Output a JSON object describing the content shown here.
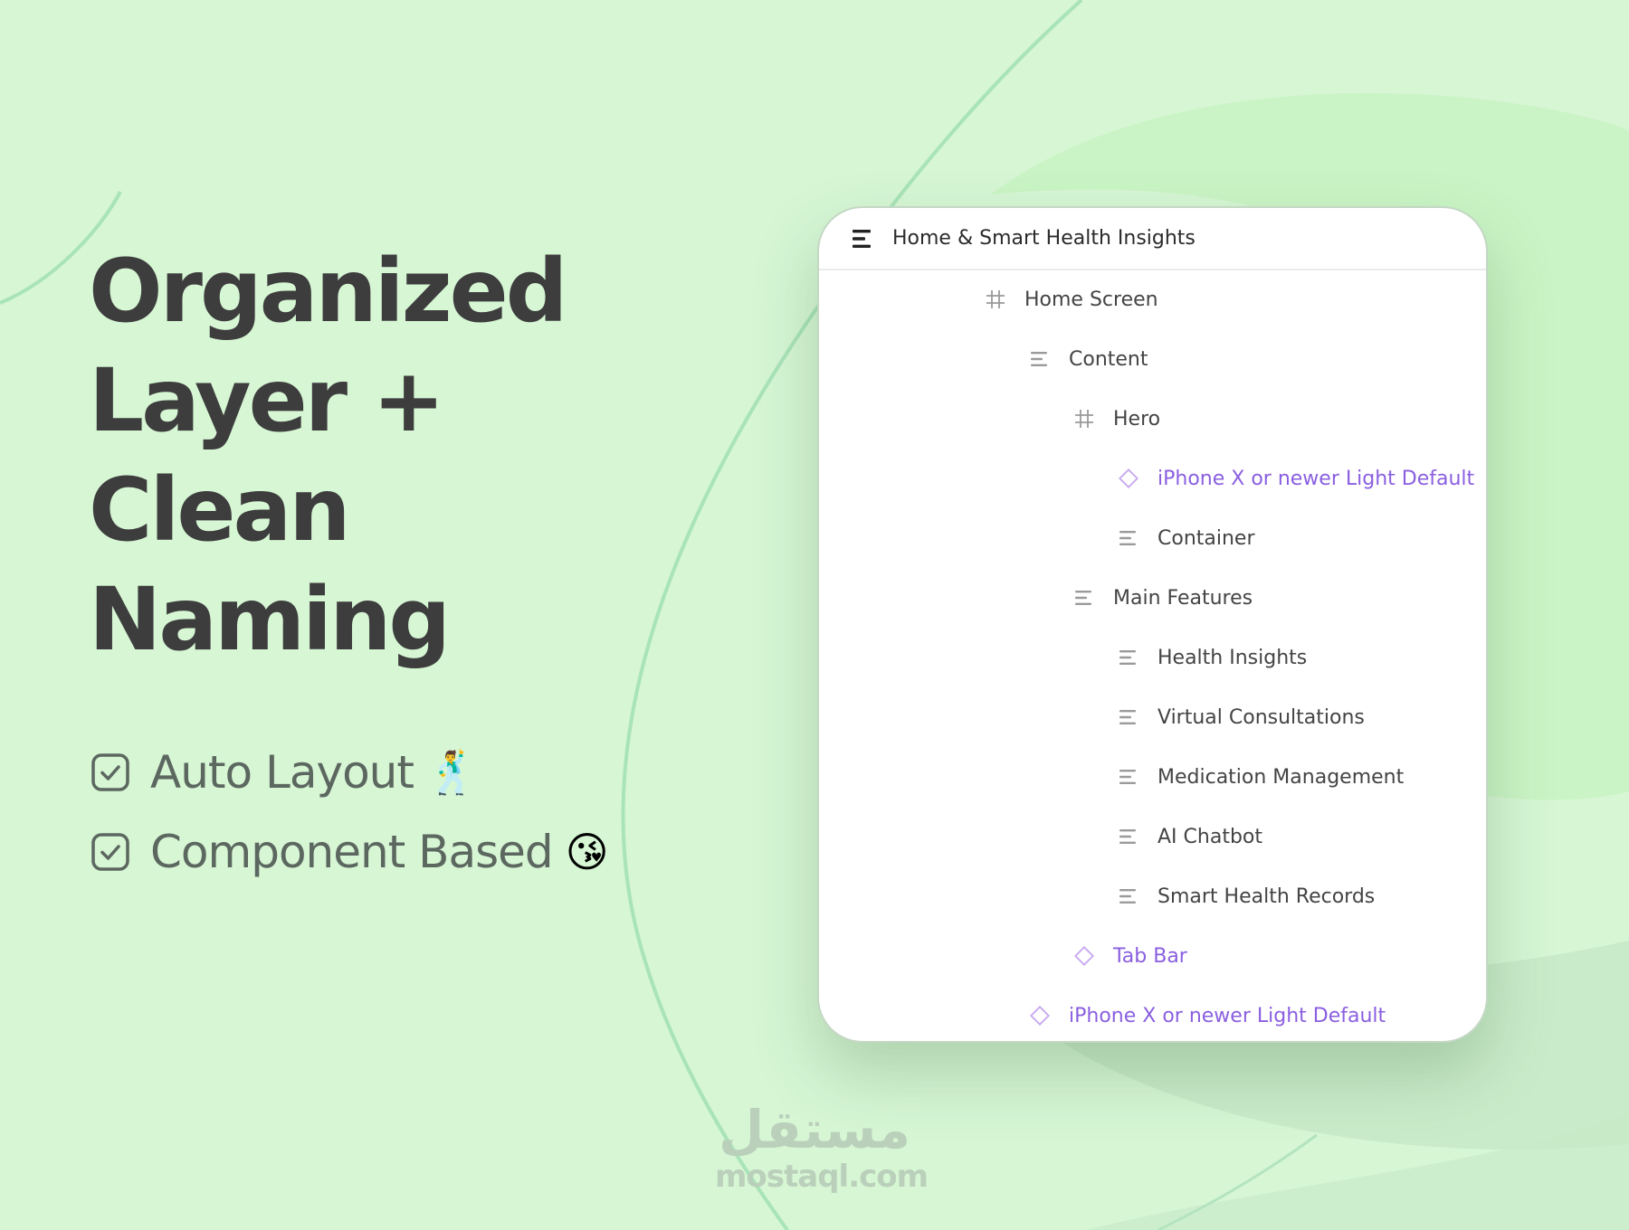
{
  "headline": {
    "lines": [
      "Organized",
      "Layer +",
      "Clean",
      "Naming"
    ]
  },
  "features": [
    {
      "icon": "checkbox-checked-icon",
      "label": "Auto Layout",
      "emoji": "🕺"
    },
    {
      "icon": "checkbox-checked-icon",
      "label": "Component Based",
      "emoji": "😘"
    }
  ],
  "panel": {
    "icon": "layers-menu-icon",
    "title": "Home & Smart Health Insights",
    "layers": [
      {
        "label": "Home Screen",
        "icon": "frame-hash-icon",
        "type": "frame",
        "depth": 0
      },
      {
        "label": "Content",
        "icon": "auto-layout-stack-icon",
        "type": "stack",
        "depth": 1
      },
      {
        "label": "Hero",
        "icon": "frame-hash-icon",
        "type": "frame",
        "depth": 2
      },
      {
        "label": "iPhone X or newer Light Default",
        "icon": "component-diamond-icon",
        "type": "component",
        "depth": 3
      },
      {
        "label": "Container",
        "icon": "auto-layout-stack-icon",
        "type": "stack",
        "depth": 3
      },
      {
        "label": "Main Features",
        "icon": "auto-layout-stack-icon",
        "type": "stack",
        "depth": 2
      },
      {
        "label": "Health Insights",
        "icon": "auto-layout-stack-icon",
        "type": "stack",
        "depth": 3
      },
      {
        "label": "Virtual Consultations",
        "icon": "auto-layout-stack-icon",
        "type": "stack",
        "depth": 3
      },
      {
        "label": "Medication Management",
        "icon": "auto-layout-stack-icon",
        "type": "stack",
        "depth": 3
      },
      {
        "label": "AI Chatbot",
        "icon": "auto-layout-stack-icon",
        "type": "stack",
        "depth": 3
      },
      {
        "label": "Smart Health Records",
        "icon": "auto-layout-stack-icon",
        "type": "stack",
        "depth": 3
      },
      {
        "label": "Tab Bar",
        "icon": "component-diamond-icon",
        "type": "component",
        "depth": 2
      },
      {
        "label": "iPhone X or newer Light Default",
        "icon": "component-diamond-icon",
        "type": "component",
        "depth": 1
      }
    ]
  },
  "watermark": {
    "arabic": "مستقل",
    "latin": "mostaql.com"
  },
  "colors": {
    "background": "#d6f6d4",
    "headline": "#3d3d3d",
    "feature_text": "#5c6760",
    "component_purple": "#8a5fe0",
    "layer_text": "#444444",
    "curve_line": "#a9e3b8"
  }
}
